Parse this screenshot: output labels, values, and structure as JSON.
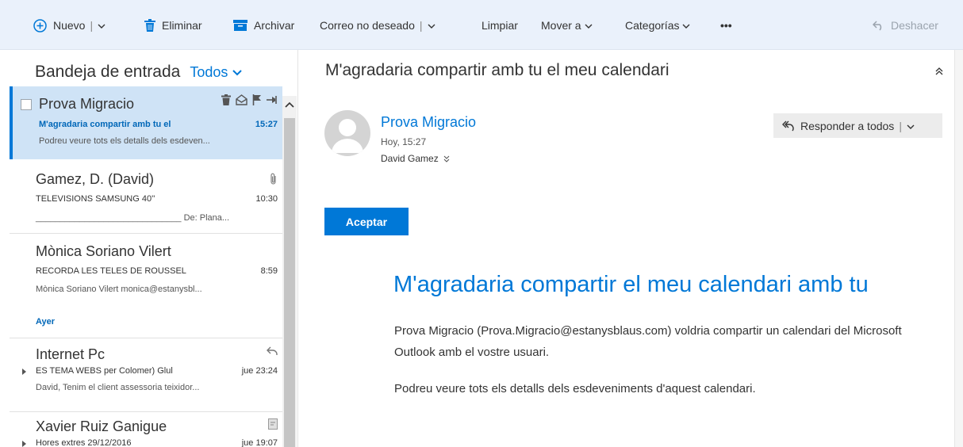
{
  "toolbar": {
    "new_label": "Nuevo",
    "delete_label": "Eliminar",
    "archive_label": "Archivar",
    "junk_label": "Correo no deseado",
    "sweep_label": "Limpiar",
    "move_label": "Mover a",
    "categories_label": "Categorías",
    "more_label": "•••",
    "undo_label": "Deshacer",
    "separator": "|"
  },
  "inbox": {
    "title": "Bandeja de entrada",
    "filter_label": "Todos",
    "group_yesterday": "Ayer",
    "messages": [
      {
        "sender": "Prova Migracio",
        "subject": "M'agradaria compartir amb tu el",
        "time": "15:27",
        "preview": "Podreu veure tots els detalls dels esdeven..."
      },
      {
        "sender": "Gamez, D. (David)",
        "subject": "TELEVISIONS SAMSUNG 40''",
        "time": "10:30",
        "preview": "______________________________ De: Plana..."
      },
      {
        "sender": "Mònica Soriano Vilert",
        "subject": "RECORDA LES TELES DE ROUSSEL",
        "time": "8:59",
        "preview": "Mònica Soriano Vilert monica@estanysbl..."
      },
      {
        "sender": "Internet Pc",
        "subject": "ES TEMA WEBS per Colomer) Glul",
        "time": "jue 23:24",
        "preview": "David, Tenim el client assessoria teixidor..."
      },
      {
        "sender": "Xavier Ruiz Ganigue",
        "subject": "Hores extres 29/12/2016",
        "time": "jue 19:07",
        "preview": ""
      }
    ]
  },
  "reading": {
    "title": "M'agradaria compartir amb tu el meu calendari",
    "sender": "Prova Migracio",
    "date": "Hoy, 15:27",
    "to": "David Gamez",
    "reply_all_label": "Responder a todos",
    "accept_label": "Aceptar",
    "body_heading": "M'agradaria compartir el meu calendari amb tu",
    "body_p1": "Prova Migracio (Prova.Migracio@estanysblaus.com) voldria compartir un calendari del Microsoft Outlook amb el vostre usuari.",
    "body_p2": "Podreu veure tots els detalls dels esdeveniments d'aquest calendari."
  },
  "colors": {
    "accent": "#0078d7",
    "toolbar_bg": "#eaf1fb",
    "selected_bg": "#cfe3f6"
  }
}
